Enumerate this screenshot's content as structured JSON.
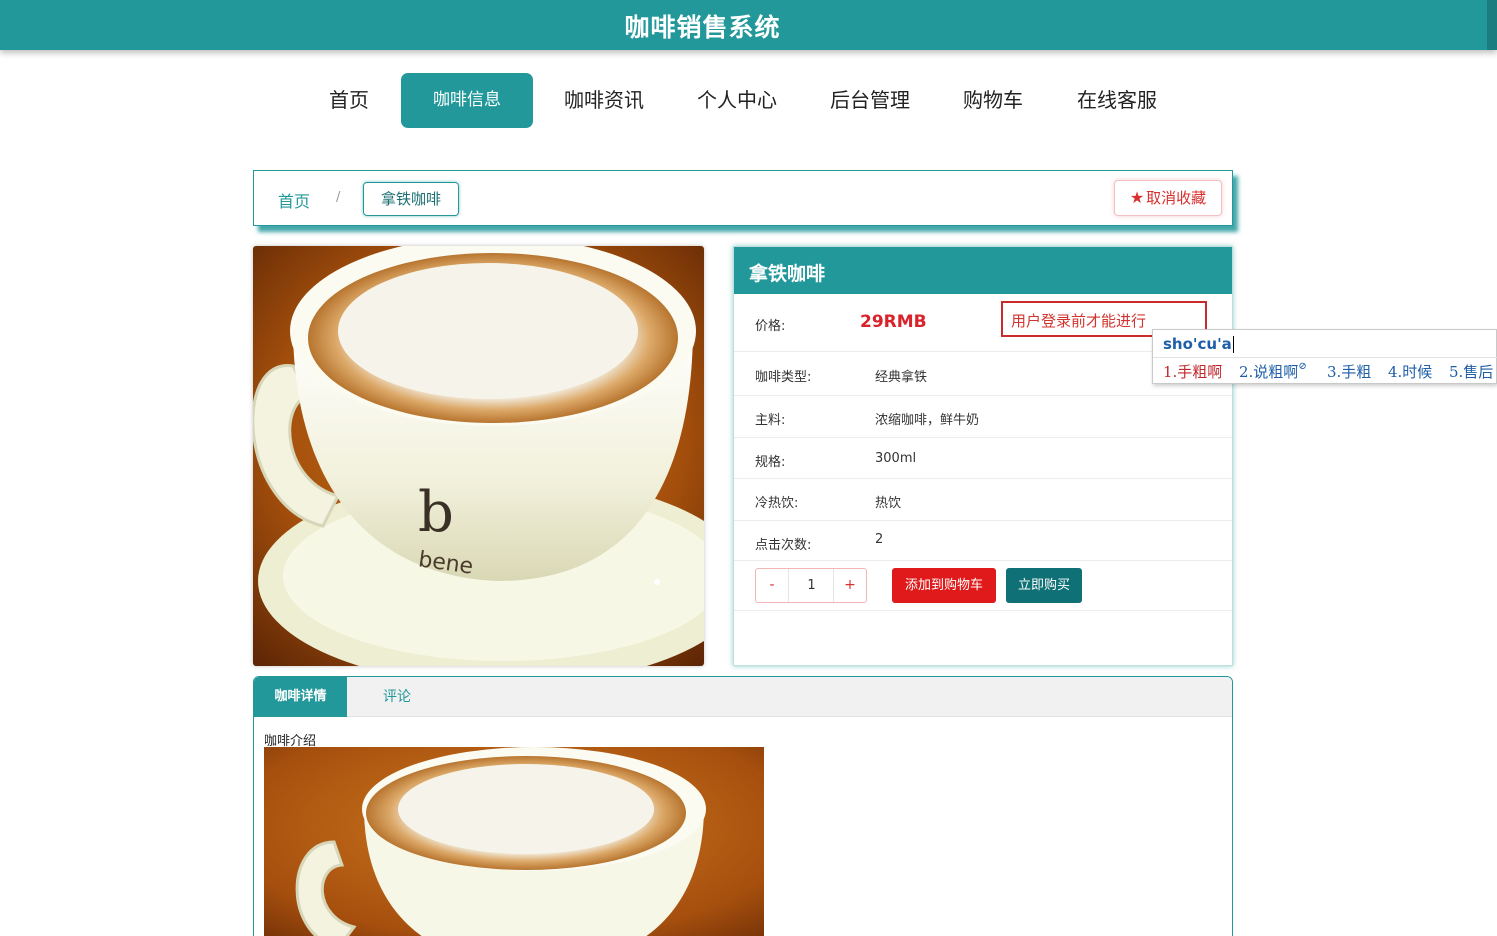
{
  "header": {
    "title": "咖啡销售系统"
  },
  "nav": {
    "items": [
      {
        "label": "首页"
      },
      {
        "label": "咖啡信息",
        "active": true
      },
      {
        "label": "咖啡资讯"
      },
      {
        "label": "个人中心"
      },
      {
        "label": "后台管理"
      },
      {
        "label": "购物车"
      },
      {
        "label": "在线客服"
      }
    ]
  },
  "breadcrumb": {
    "home": "首页",
    "separator": "/",
    "current": "拿铁咖啡"
  },
  "favorite_button": {
    "label": "取消收藏",
    "icon": "star-icon"
  },
  "product": {
    "name": "拿铁咖啡",
    "price_label": "价格:",
    "price": "29RMB",
    "login_notice": "用户登录前才能进行",
    "fields": [
      {
        "label": "咖啡类型:",
        "value": "经典拿铁"
      },
      {
        "label": "主料:",
        "value": "浓缩咖啡，鲜牛奶"
      },
      {
        "label": "规格:",
        "value": "300ml"
      },
      {
        "label": "冷热饮:",
        "value": "热饮"
      },
      {
        "label": "点击次数:",
        "value": "2"
      }
    ],
    "quantity": {
      "minus": "-",
      "value": "1",
      "plus": "+"
    },
    "add_to_cart_label": "添加到购物车",
    "buy_now_label": "立即购买"
  },
  "ime": {
    "input": "sho'cu'a",
    "candidates": [
      "1.手粗啊",
      "2.说粗啊",
      "3.手粗",
      "4.时候",
      "5.售后"
    ]
  },
  "tabs": {
    "items": [
      {
        "label": "咖啡详情",
        "active": true
      },
      {
        "label": "评论"
      }
    ],
    "intro_title": "咖啡介绍"
  },
  "colors": {
    "primary": "#22989a",
    "danger": "#e01a1a",
    "dark_teal": "#0f7075",
    "price_red": "#d9222a"
  }
}
